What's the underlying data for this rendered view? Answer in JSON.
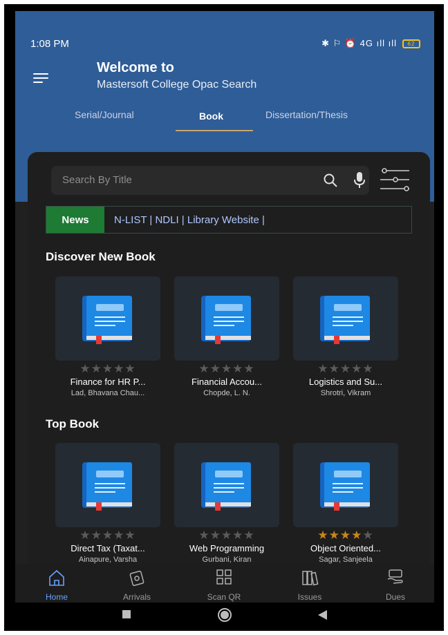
{
  "status_bar": {
    "time": "1:08 PM",
    "indicators": "✱ ⚐ ⏰ 4G ıll ıll",
    "battery": "62"
  },
  "header": {
    "welcome": "Welcome to",
    "subtitle": "Mastersoft College Opac Search"
  },
  "tabs": [
    {
      "label": "Serial/Journal",
      "active": false
    },
    {
      "label": "Book",
      "active": true
    },
    {
      "label": "Dissertation/Thesis",
      "active": false
    }
  ],
  "search": {
    "placeholder": "Search By Title"
  },
  "news": {
    "badge": "News",
    "text": "N-LIST | NDLI | Library Website |"
  },
  "discover": {
    "title": "Discover New Book",
    "books": [
      {
        "title": "Finance for HR P...",
        "author": "Lad, Bhavana Chau...",
        "rating": 0
      },
      {
        "title": "Financial Accou...",
        "author": "Chopde, L. N.",
        "rating": 0
      },
      {
        "title": "Logistics and Su...",
        "author": "Shrotri, Vikram",
        "rating": 0
      }
    ]
  },
  "top": {
    "title": "Top Book",
    "books": [
      {
        "title": "Direct Tax (Taxat...",
        "author": "Ainapure, Varsha",
        "rating": 0
      },
      {
        "title": "Web Programming",
        "author": "Gurbani, Kiran",
        "rating": 0
      },
      {
        "title": "Object Oriented...",
        "author": "Sagar, Sanjeela",
        "rating": 4
      }
    ]
  },
  "nav": [
    {
      "label": "Home",
      "icon": "home-icon",
      "active": true
    },
    {
      "label": "Arrivals",
      "icon": "arrivals-icon",
      "active": false
    },
    {
      "label": "Scan QR",
      "icon": "qr-icon",
      "active": false
    },
    {
      "label": "Issues",
      "icon": "books-icon",
      "active": false
    },
    {
      "label": "Dues",
      "icon": "dues-icon",
      "active": false
    }
  ],
  "colors": {
    "header": "#2f5d97",
    "news_badge": "#1e7b34",
    "book_icon": "#1e88e5",
    "active_nav": "#6aa2ff",
    "star_on": "#c8861c"
  }
}
